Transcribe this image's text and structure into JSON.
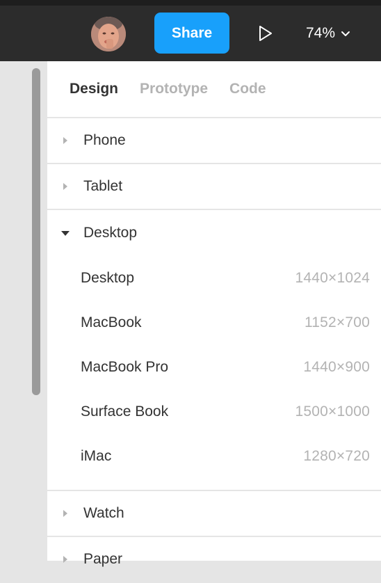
{
  "toolbar": {
    "share_label": "Share",
    "zoom_label": "74%",
    "icons": {
      "avatar": "user-avatar",
      "play": "play-icon",
      "zoom_dropdown": "chevron-down-icon"
    },
    "colors": {
      "toolbar_bg": "#2c2c2c",
      "share_bg": "#18a0fb"
    }
  },
  "tabs": [
    {
      "label": "Design",
      "active": true
    },
    {
      "label": "Prototype",
      "active": false
    },
    {
      "label": "Code",
      "active": false
    }
  ],
  "sections": [
    {
      "label": "Phone",
      "expanded": false
    },
    {
      "label": "Tablet",
      "expanded": false
    },
    {
      "label": "Desktop",
      "expanded": true,
      "items": [
        {
          "name": "Desktop",
          "size": "1440×1024"
        },
        {
          "name": "MacBook",
          "size": "1152×700"
        },
        {
          "name": "MacBook Pro",
          "size": "1440×900"
        },
        {
          "name": "Surface Book",
          "size": "1500×1000"
        },
        {
          "name": "iMac",
          "size": "1280×720"
        }
      ]
    },
    {
      "label": "Watch",
      "expanded": false
    },
    {
      "label": "Paper",
      "expanded": false
    }
  ]
}
